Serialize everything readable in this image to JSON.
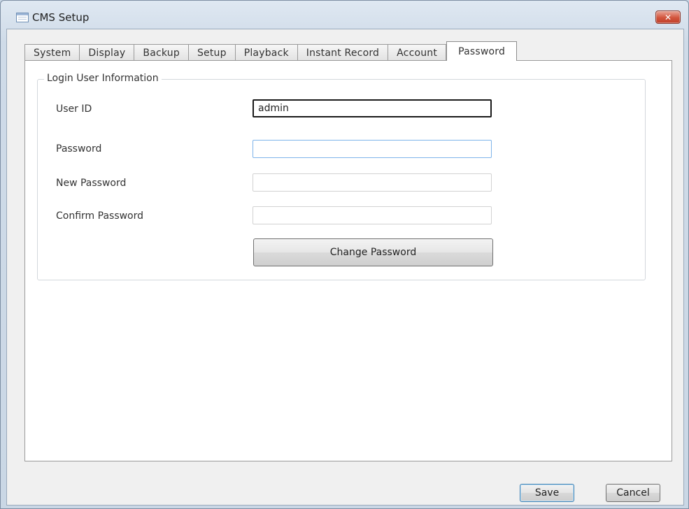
{
  "window": {
    "title": "CMS Setup",
    "close_glyph": "✕",
    "icon": "app-window-icon"
  },
  "tabs": [
    {
      "label": "System",
      "active": false
    },
    {
      "label": "Display",
      "active": false
    },
    {
      "label": "Backup",
      "active": false
    },
    {
      "label": "Setup",
      "active": false
    },
    {
      "label": "Playback",
      "active": false
    },
    {
      "label": "Instant Record",
      "active": false
    },
    {
      "label": "Account",
      "active": false
    },
    {
      "label": "Password",
      "active": true
    }
  ],
  "login_group": {
    "legend": "Login User Information",
    "user_id": {
      "label": "User ID",
      "value": "admin"
    },
    "password": {
      "label": "Password",
      "value": ""
    },
    "new_password": {
      "label": "New Password",
      "value": ""
    },
    "confirm_password": {
      "label": "Confirm Password",
      "value": ""
    },
    "change_button": "Change Password"
  },
  "footer": {
    "save_label": "Save",
    "cancel_label": "Cancel"
  },
  "colors": {
    "frame": "#c9d7e6",
    "close_button": "#d2553d",
    "focus_border": "#1a1a1a",
    "default_button_border": "#3c7fb1"
  }
}
